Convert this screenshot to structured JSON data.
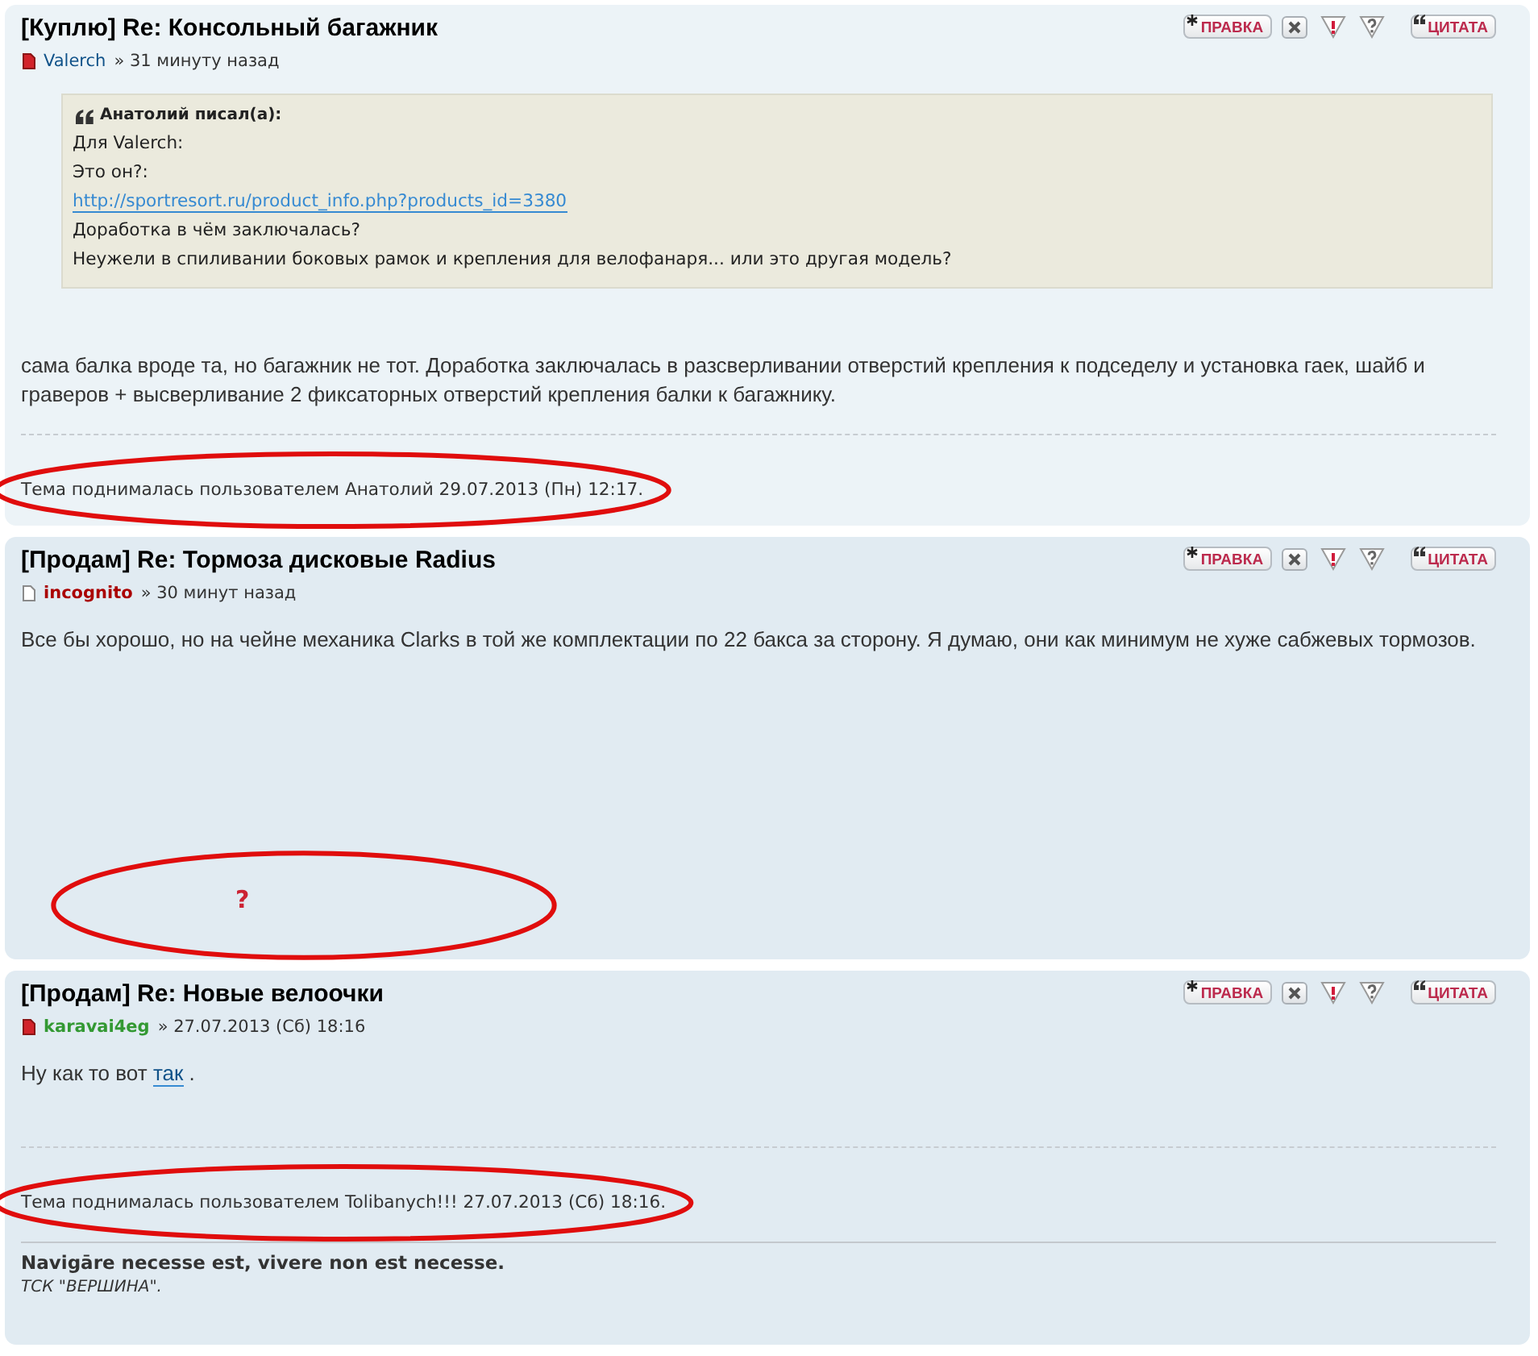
{
  "posts": [
    {
      "color": "#ecf3f7",
      "title": "[Куплю] Re: Консольный багажник",
      "unread": true,
      "author": {
        "name": "Valerch",
        "kind": "member",
        "color": "#105289"
      },
      "time": "» 31 минуту назад",
      "buttons": [
        {
          "kind": "edit",
          "label": "ПРАВКА"
        },
        {
          "kind": "delete"
        },
        {
          "kind": "report"
        },
        {
          "kind": "info"
        },
        {
          "kind": "quote",
          "label": "ЦИТАТА"
        }
      ],
      "quote": {
        "heading": "Анатолий писал(а):",
        "lines": [
          {
            "kind": "text",
            "text": "Для Valerch:"
          },
          {
            "kind": "text",
            "text": "Это он?:"
          },
          {
            "kind": "link",
            "text": "http://sportresort.ru/product_info.php?products_id=3380"
          },
          {
            "kind": "text",
            "text": "Доработка в чём заключалась?"
          },
          {
            "kind": "text",
            "text": "Неужели в спиливании боковых рамок и крепления для велофанаря... или это другая модель?"
          }
        ]
      },
      "body": [
        {
          "kind": "text",
          "text": "сама балка вроде та, но багажник не тот. Доработка заключалась в разсверливании отверстий крепления к подседелу и установка гаек, шайб и граверов + высверливание 2 фиксаторных отверстий крепления балки к багажнику."
        }
      ],
      "footer": {
        "kind": "notice",
        "text": "Тема поднималась пользователем Анатолий 29.07.2013 (Пн) 12:17.",
        "circled": true
      }
    },
    {
      "color": "#e1ebf2",
      "title": "[Продам] Re: Тормоза дисковые Radius",
      "unread": false,
      "author": {
        "name": "incognito",
        "kind": "group",
        "color": "#aa0000"
      },
      "time": "» 30 минут назад",
      "buttons": [
        {
          "kind": "edit",
          "label": "ПРАВКА"
        },
        {
          "kind": "delete"
        },
        {
          "kind": "report"
        },
        {
          "kind": "info"
        },
        {
          "kind": "quote",
          "label": "ЦИТАТА"
        }
      ],
      "body": [
        {
          "kind": "text",
          "text": "Все бы хорошо, но на чейне механика Clarks в той же комплектации по 22 бакса за сторону. Я думаю, они как минимум не хуже сабжевых тормозов."
        }
      ],
      "footer": {
        "kind": "query",
        "text": "?",
        "circled": true
      }
    },
    {
      "color": "#e1ebf2",
      "title": "[Продам] Re: Новые велоочки",
      "unread": true,
      "author": {
        "name": "karavai4eg",
        "kind": "group",
        "color": "#339933"
      },
      "time": "» 27.07.2013 (Сб) 18:16",
      "buttons": [
        {
          "kind": "edit",
          "label": "ПРАВКА"
        },
        {
          "kind": "delete"
        },
        {
          "kind": "report"
        },
        {
          "kind": "info"
        },
        {
          "kind": "quote",
          "label": "ЦИТАТА"
        }
      ],
      "body": [
        {
          "kind": "text",
          "text": "Ну как то вот "
        },
        {
          "kind": "link",
          "text": "так"
        },
        {
          "kind": "text",
          "text": " ."
        }
      ],
      "footer": {
        "kind": "notice",
        "text": "Тема поднималась пользователем Tolibanych!!! 27.07.2013 (Сб) 18:16.",
        "circled": true
      },
      "signature": [
        {
          "kind": "bold",
          "text": "Navigāre necesse est, vivere non est necesse."
        },
        {
          "kind": "italic",
          "text": "ТСК \"ВЕРШИНА\"."
        }
      ]
    }
  ]
}
